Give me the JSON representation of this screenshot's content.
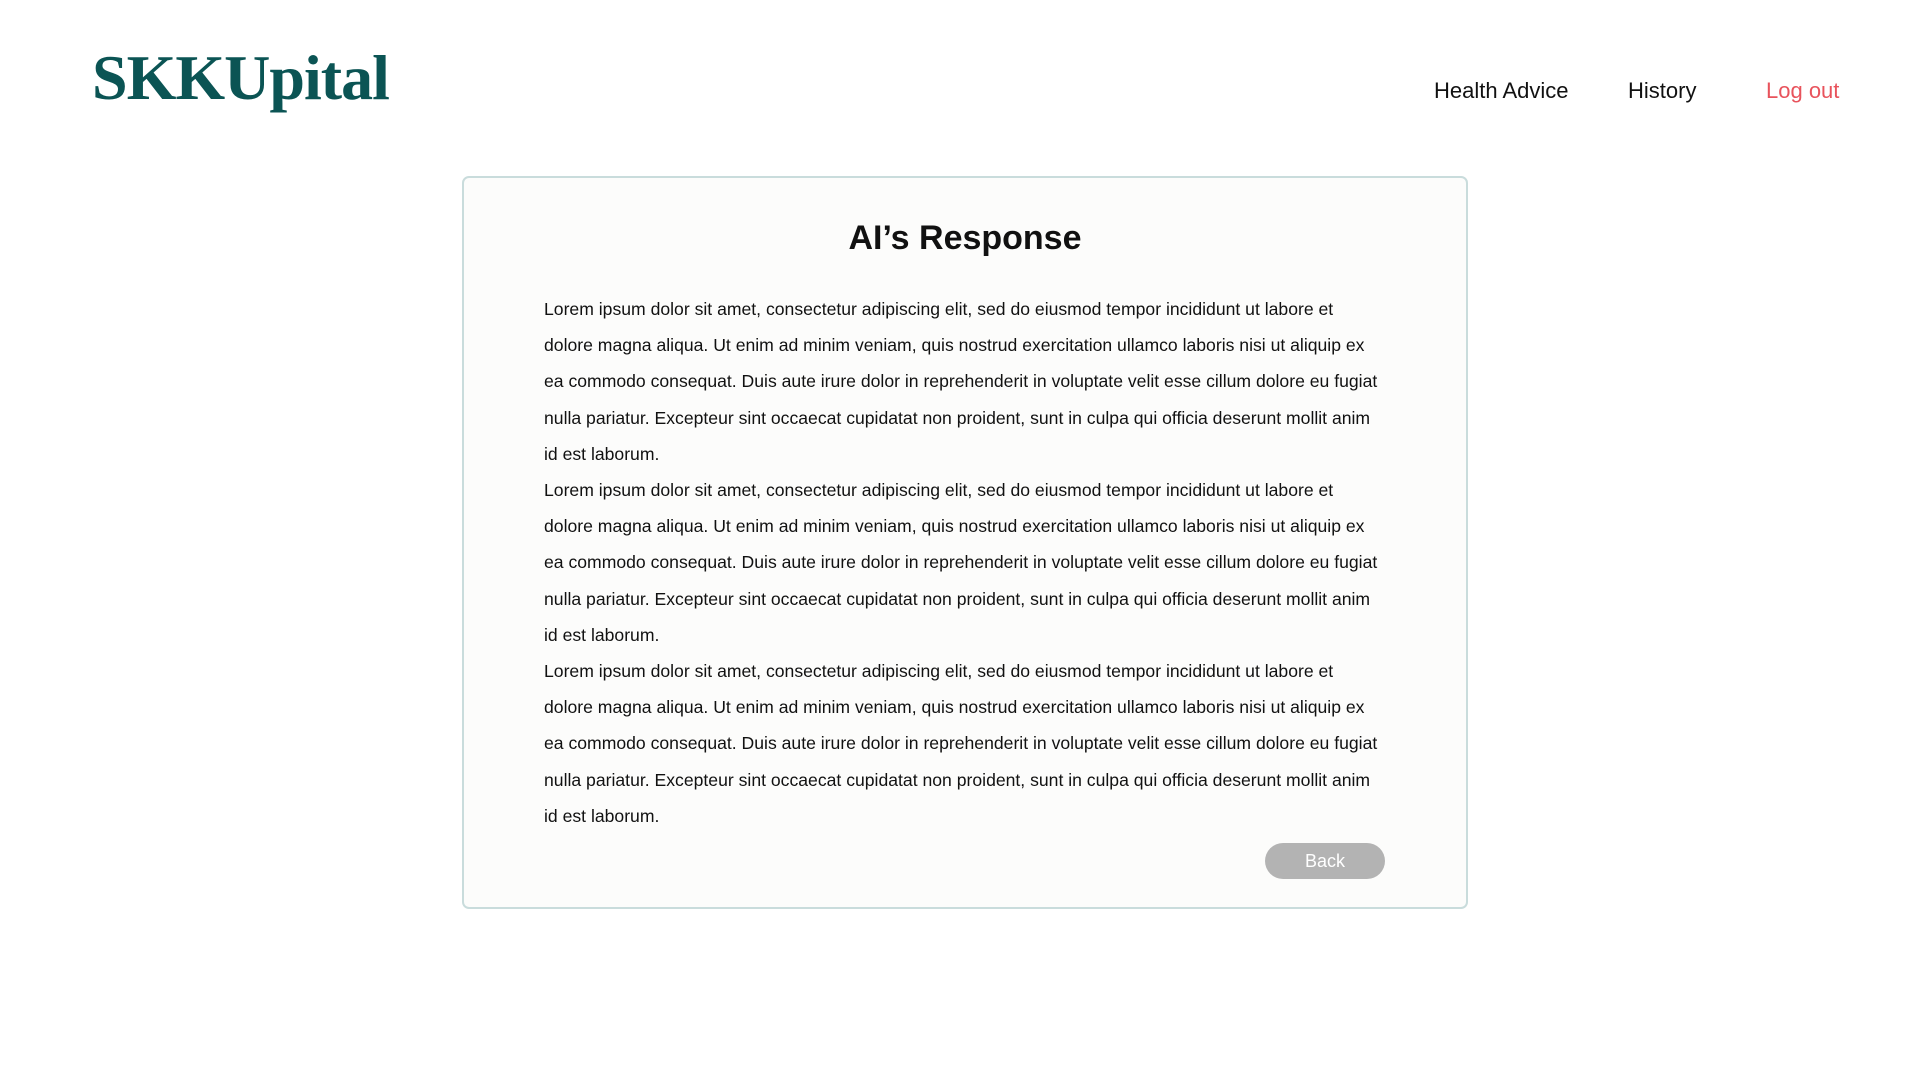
{
  "header": {
    "logo": "SKKUpital",
    "nav": {
      "health_advice": "Health Advice",
      "history": "History",
      "log_out": "Log out"
    }
  },
  "card": {
    "title": "AI’s Response",
    "paragraphs": [
      "Lorem ipsum dolor sit amet, consectetur adipiscing elit, sed do eiusmod tempor incididunt ut labore et dolore magna aliqua. Ut enim ad minim veniam, quis nostrud exercitation ullamco laboris nisi ut aliquip ex ea commodo consequat. Duis aute irure dolor in reprehenderit in voluptate velit esse cillum dolore eu fugiat nulla pariatur. Excepteur sint occaecat cupidatat non proident, sunt in culpa qui officia deserunt mollit anim id est laborum.",
      "Lorem ipsum dolor sit amet, consectetur adipiscing elit, sed do eiusmod tempor incididunt ut labore et dolore magna aliqua. Ut enim ad minim veniam, quis nostrud exercitation ullamco laboris nisi ut aliquip ex ea commodo consequat. Duis aute irure dolor in reprehenderit in voluptate velit esse cillum dolore eu fugiat nulla pariatur. Excepteur sint occaecat cupidatat non proident, sunt in culpa qui officia deserunt mollit anim id est laborum.",
      "Lorem ipsum dolor sit amet, consectetur adipiscing elit, sed do eiusmod tempor incididunt ut labore et dolore magna aliqua. Ut enim ad minim veniam, quis nostrud exercitation ullamco laboris nisi ut aliquip ex ea commodo consequat. Duis aute irure dolor in reprehenderit in voluptate velit esse cillum dolore eu fugiat nulla pariatur. Excepteur sint occaecat cupidatat non proident, sunt in culpa qui officia deserunt mollit anim id est laborum."
    ],
    "back_label": "Back"
  },
  "colors": {
    "brand": "#0b5454",
    "logout": "#e8535c",
    "card_border": "#c9dcdc",
    "card_background": "#fcfcfb",
    "back_button": "#b3b3b3"
  }
}
